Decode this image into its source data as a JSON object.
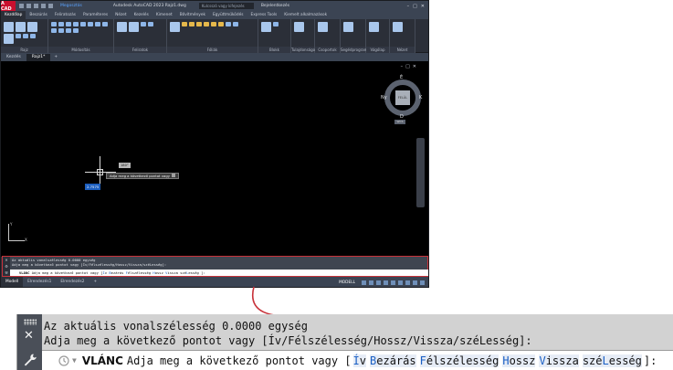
{
  "app": {
    "logo_text": "A CAD",
    "share_label": "Megosztás",
    "title": "Autodesk AutoCAD 2023   Rajz1.dwg",
    "search_placeholder": "Kulcsszó vagy kifejezés",
    "signin_label": "Bejelentkezés"
  },
  "ribbon": {
    "tabs": [
      "Kezdőlap",
      "Beszúrás",
      "Feliratozás",
      "Paraméteres",
      "Nézet",
      "Kezelés",
      "Kimenet",
      "Bővítmények",
      "Együttműködés",
      "Express Tools",
      "Kiemelt alkalmazások"
    ],
    "panels": [
      "Rajz",
      "Módosítás",
      "Feliratok",
      "Fóliák",
      "Blokk",
      "Tulajdonságok",
      "Csoportok",
      "Segédprogramok",
      "Vágólap",
      "Nézet"
    ],
    "tool_labels": {
      "line": "Vonal",
      "polyline": "Vonallánc",
      "circle": "Kör",
      "arc": "Ív",
      "text": "Szöveg",
      "dimension": "Méretezés",
      "layer_props": "Fólia- tulajdonságok",
      "insert": "Beszúrás",
      "properties": "Tulajdon...",
      "groups": "Csoport",
      "utilities": "Segédpr...",
      "clipboard": "Vágólap",
      "view": "Nézet"
    }
  },
  "file_tabs": [
    "Kezdés",
    "Rajz1*"
  ],
  "canvas": {
    "viewcube": {
      "top": "É",
      "bottom": "D",
      "left": "Ny",
      "right": "K",
      "face": "FELÜL"
    },
    "wcs_label": "WCS",
    "angle_tooltip": "180°",
    "prompt_tooltip": "Adja meg a következő pontot vagy",
    "dynamic_input_value": "2.7575",
    "ucs_x": "X",
    "ucs_y": "Y"
  },
  "layout_tabs": [
    "Modell",
    "Elrendezés1",
    "Elrendezés2"
  ],
  "status": {
    "model_label": "MODELL"
  },
  "command_line": {
    "history": [
      "Az aktuális vonalszélesség 0.0000 egység",
      "Adja meg a következő pontot vagy [Ív/Félszélesség/Hossz/Vissza/széLesség]:"
    ],
    "command_name": "VLÁNC",
    "prompt": "Adja meg a következő pontot vagy [",
    "options": [
      {
        "key": "Í",
        "rest": "v"
      },
      {
        "key": "B",
        "rest": "ezárás"
      },
      {
        "key": "F",
        "rest": "élszélesség"
      },
      {
        "key": "H",
        "rest": "ossz"
      },
      {
        "key": "V",
        "rest": "issza"
      },
      {
        "pre": "szé",
        "key": "L",
        "rest": "esség"
      }
    ],
    "suffix": "]:"
  },
  "colors": {
    "highlight_border": "#c8323a",
    "option_key": "#1a5fc4",
    "canvas_bg": "#000000",
    "dynamic_input_bg": "#1d5fbf"
  }
}
